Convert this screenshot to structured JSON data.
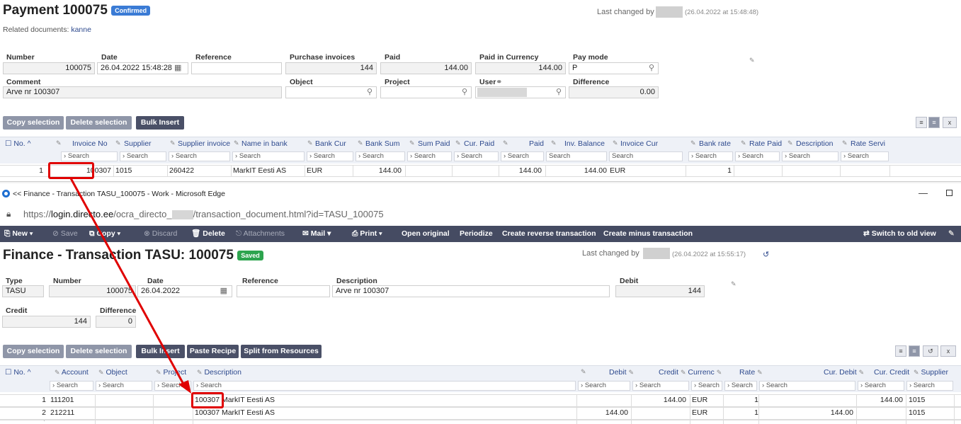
{
  "payment": {
    "title": "Payment 100075",
    "status": "Confirmed",
    "status_color": "#3a7bd5",
    "last_changed_label": "Last changed by",
    "last_changed_time": "(26.04.2022 at 15:48:48)",
    "related_label": "Related documents:",
    "related_link": "kanne",
    "labels": {
      "number": "Number",
      "date": "Date",
      "reference": "Reference",
      "purchase_invoices": "Purchase invoices",
      "paid": "Paid",
      "paid_currency": "Paid in Currency",
      "pay_mode": "Pay mode",
      "comment": "Comment",
      "object": "Object",
      "project": "Project",
      "user": "User",
      "difference": "Difference"
    },
    "values": {
      "number": "100075",
      "date": "26.04.2022 15:48:28",
      "purchase_invoices": "144",
      "paid": "144.00",
      "paid_currency": "144.00",
      "pay_mode": "P",
      "comment": "Arve nr 100307",
      "difference": "0.00"
    },
    "buttons": {
      "copy": "Copy selection",
      "delete": "Delete selection",
      "bulk": "Bulk Insert"
    },
    "columns": [
      "No.",
      "Invoice No",
      "Supplier",
      "Supplier invoice",
      "Name in bank",
      "Bank Cur",
      "Bank Sum",
      "Sum Paid",
      "Cur. Paid",
      "Paid",
      "Inv. Balance",
      "Invoice Cur",
      "Bank rate",
      "Rate Paid",
      "Description",
      "Rate Servi"
    ],
    "search": "Search",
    "row": {
      "no": "1",
      "invoice_no": "100307",
      "supplier": "1015",
      "supplier_invoice": "260422",
      "name_in_bank": "MarkIT Eesti AS",
      "bank_cur": "EUR",
      "bank_sum": "144.00",
      "paid": "144.00",
      "inv_balance": "144.00",
      "invoice_cur": "EUR",
      "bank_rate": "1"
    }
  },
  "window": {
    "title": "<< Finance - Transaction TASU_100075 - Work - Microsoft Edge",
    "url_prefix": "https://",
    "url_host": "login.directo.ee",
    "url_path": "/ocra_directo_",
    "url_rest": "/transaction_document.html?id=TASU_100075"
  },
  "toolbar": {
    "new": "New",
    "save": "Save",
    "copy": "Copy",
    "discard": "Discard",
    "delete": "Delete",
    "attachments": "Attachments",
    "mail": "Mail",
    "print": "Print",
    "open_original": "Open original",
    "periodize": "Periodize",
    "create_reverse": "Create reverse transaction",
    "create_minus": "Create minus transaction",
    "switch_old": "Switch to old view"
  },
  "transaction": {
    "title": "Finance - Transaction TASU: 100075",
    "status": "Saved",
    "status_color": "#2da44e",
    "last_changed_label": "Last changed by",
    "last_changed_time": "(26.04.2022 at 15:55:17)",
    "labels": {
      "type": "Type",
      "number": "Number",
      "date": "Date",
      "reference": "Reference",
      "description": "Description",
      "debit": "Debit",
      "credit": "Credit",
      "difference": "Difference"
    },
    "values": {
      "type": "TASU",
      "number": "100075",
      "date": "26.04.2022",
      "description": "Arve nr 100307",
      "debit": "144",
      "credit": "144",
      "difference": "0"
    },
    "buttons": {
      "copy": "Copy selection",
      "delete": "Delete selection",
      "bulk": "Bulk Insert",
      "paste": "Paste Recipe",
      "split": "Split from Resources"
    },
    "columns": [
      "No.",
      "Account",
      "Object",
      "Project",
      "Description",
      "Debit",
      "Credit",
      "Currenc",
      "Rate",
      "Cur. Debit",
      "Cur. Credit",
      "Supplier"
    ],
    "rows": [
      {
        "no": "1",
        "account": "111201",
        "desc_num": "100307",
        "desc_rest": " MarkIT Eesti AS",
        "debit": "",
        "credit": "144.00",
        "cur": "EUR",
        "rate": "1",
        "cur_debit": "",
        "cur_credit": "144.00",
        "supplier": "1015"
      },
      {
        "no": "2",
        "account": "212211",
        "desc_num": "100307",
        "desc_rest": " MarkIT Eesti AS",
        "debit": "144.00",
        "credit": "",
        "cur": "EUR",
        "rate": "1",
        "cur_debit": "144.00",
        "cur_credit": "",
        "supplier": "1015"
      }
    ]
  },
  "colors": {
    "highlight": "#e00000",
    "toolbar": "#454b62",
    "btn_gray": "#8f96a8",
    "btn_dark": "#4a5067",
    "link": "#2e4a8e"
  }
}
